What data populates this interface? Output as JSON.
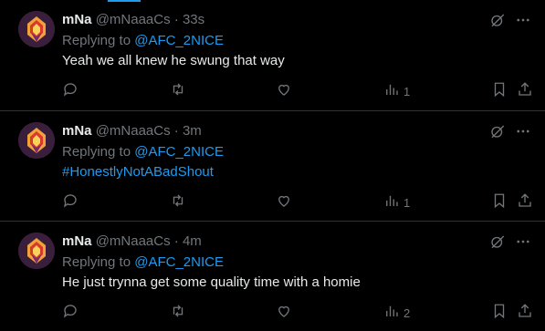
{
  "tweets": [
    {
      "name": "mNa",
      "handle": "@mNaaaCs",
      "dot": "·",
      "time": "33s",
      "replying_prefix": "Replying to ",
      "replying_to": "@AFC_2NICE",
      "text": "Yeah we all knew he swung that way",
      "text_is_hashtag": false,
      "views": "1"
    },
    {
      "name": "mNa",
      "handle": "@mNaaaCs",
      "dot": "·",
      "time": "3m",
      "replying_prefix": "Replying to ",
      "replying_to": "@AFC_2NICE",
      "text": "#HonestlyNotABadShout",
      "text_is_hashtag": true,
      "views": "1"
    },
    {
      "name": "mNa",
      "handle": "@mNaaaCs",
      "dot": "·",
      "time": "4m",
      "replying_prefix": "Replying to ",
      "replying_to": "@AFC_2NICE",
      "text": "He just trynna get some quality time with a homie",
      "text_is_hashtag": false,
      "views": "2"
    }
  ],
  "icons": {
    "grok": "grok-icon",
    "more": "more-icon",
    "reply": "reply-icon",
    "retweet": "retweet-icon",
    "like": "like-icon",
    "views": "views-icon",
    "bookmark": "bookmark-icon",
    "share": "share-icon"
  },
  "colors": {
    "background": "#000000",
    "text": "#e7e9ea",
    "muted": "#71767b",
    "accent": "#1d9bf0",
    "divider": "#2f3336"
  }
}
